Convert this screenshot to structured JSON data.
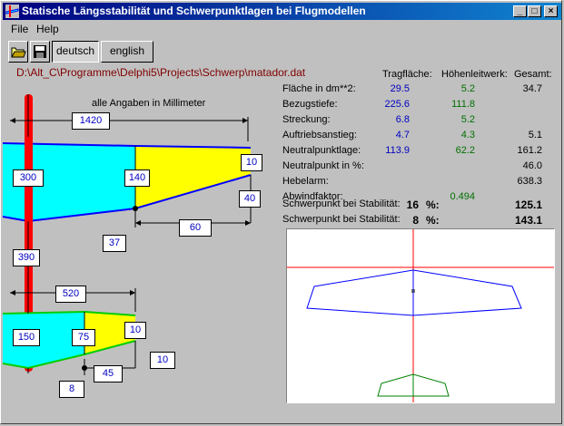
{
  "window": {
    "title": "Statische Längsstabilität und Schwerpunktlagen bei Flugmodellen",
    "minimize": "_",
    "maximize": "□",
    "close": "×"
  },
  "menu": {
    "file": "File",
    "help": "Help"
  },
  "toolbar": {
    "deutsch": "deutsch",
    "english": "english"
  },
  "file_path": "D:\\Alt_C\\Programme\\Delphi5\\Projects\\Schwerp\\matador.dat",
  "diagram": {
    "note": "alle Angaben in Millimeter",
    "main_span": "1420",
    "main_root_chord": "300",
    "main_mid_chord": "140",
    "main_tip_chord": "10",
    "main_tip_offset": "40",
    "main_sweep_len": "60",
    "main_offset": "37",
    "distance": "390",
    "tail_span": "520",
    "tail_root_chord": "150",
    "tail_mid_chord": "75",
    "tail_tip_chord": "10",
    "tail_tip_offset": "10",
    "tail_sweep_len": "45",
    "tail_offset": "8"
  },
  "table": {
    "headers": {
      "wing": "Tragfläche:",
      "tail": "Höhenleitwerk:",
      "total": "Gesamt:"
    },
    "rows": [
      {
        "label": "Fläche in dm**2:",
        "wing": "29.5",
        "tail": "5.2",
        "total": "34.7"
      },
      {
        "label": "Bezugstiefe:",
        "wing": "225.6",
        "tail": "111.8",
        "total": ""
      },
      {
        "label": "Streckung:",
        "wing": "6.8",
        "tail": "5.2",
        "total": ""
      },
      {
        "label": "Auftriebsanstieg:",
        "wing": "4.7",
        "tail": "4.3",
        "total": "5.1"
      },
      {
        "label": "Neutralpunktlage:",
        "wing": "113.9",
        "tail": "62.2",
        "total": "161.2"
      },
      {
        "label": "Neutralpunkt in %:",
        "wing": "",
        "tail": "",
        "total": "46.0"
      },
      {
        "label": "Hebelarm:",
        "wing": "",
        "tail": "",
        "total": "638.3"
      },
      {
        "label": "Abwindfaktor:",
        "wing": "",
        "tail": "0.494",
        "total": ""
      }
    ],
    "stability": [
      {
        "label": "Schwerpunkt bei Stabilität:",
        "value": "16",
        "unit": "%:",
        "result": "125.1"
      },
      {
        "label": "Schwerpunkt bei Stabilität:",
        "value": "8",
        "unit": "%:",
        "result": "143.1"
      }
    ]
  },
  "colors": {
    "wing_fill_root": "#00ffff",
    "wing_fill_tip": "#ffff00",
    "wing_outline": "#0000ff",
    "tail_outline": "#00cc00",
    "fuselage": "#ff0000",
    "preview_wing": "#0000ff",
    "preview_tail": "#008000",
    "preview_axis": "#ff0000"
  }
}
